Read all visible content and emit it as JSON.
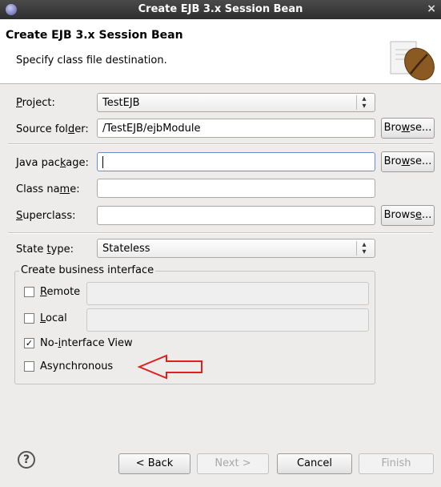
{
  "window": {
    "title": "Create EJB 3.x Session Bean",
    "close_glyph": "×",
    "icon": "app-circle-icon"
  },
  "header": {
    "title": "Create EJB 3.x Session Bean",
    "subtitle": "Specify class file destination.",
    "image": "coffee-bean-icon"
  },
  "form": {
    "project_label_pre": "",
    "project_label_mn": "P",
    "project_label_post": "roject:",
    "project_value": "TestEJB",
    "source_label_pre": "Source fol",
    "source_label_mn": "d",
    "source_label_post": "er:",
    "source_value": "/TestEJB/ejbModule",
    "package_label_pre": "Java pac",
    "package_label_mn": "k",
    "package_label_post": "age:",
    "package_value": "",
    "class_label_pre": "Class na",
    "class_label_mn": "m",
    "class_label_post": "e:",
    "class_value": "",
    "super_label_pre": "",
    "super_label_mn": "S",
    "super_label_post": "uperclass:",
    "super_value": "",
    "browse1_pre": "Bro",
    "browse1_mn": "w",
    "browse1_post": "se...",
    "browse2_pre": "Bro",
    "browse2_mn": "w",
    "browse2_post": "se...",
    "browse3_pre": "Brows",
    "browse3_mn": "e",
    "browse3_post": "...",
    "state_label_pre": "State ",
    "state_label_mn": "t",
    "state_label_post": "ype:",
    "state_value": "Stateless"
  },
  "business": {
    "group_label": "Create business interface",
    "remote_pre": "",
    "remote_mn": "R",
    "remote_post": "emote",
    "remote_checked": false,
    "local_pre": "",
    "local_mn": "L",
    "local_post": "ocal",
    "local_checked": false,
    "nointerface_pre": "No-",
    "nointerface_mn": "i",
    "nointerface_post": "nterface View",
    "nointerface_checked": true,
    "async_label": "Asynchronous",
    "async_checked": false,
    "check_mark": "✓"
  },
  "annotation": {
    "arrow_color": "#e02020"
  },
  "footer": {
    "help_glyph": "?",
    "back": "< Back",
    "next": "Next >",
    "cancel": "Cancel",
    "finish": "Finish"
  }
}
